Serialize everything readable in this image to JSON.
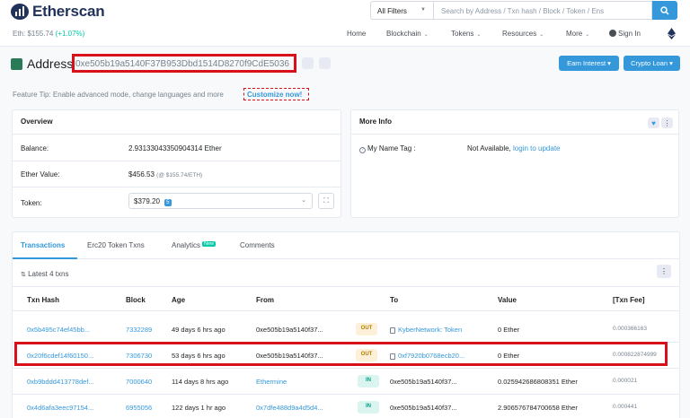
{
  "header": {
    "logo_text": "Etherscan",
    "filter_label": "All Filters",
    "search_placeholder": "Search by Address / Txn hash / Block / Token / Ens",
    "eth_price_label": "Eth: $155.74",
    "eth_price_change": "(+1.07%)",
    "nav": [
      {
        "label": "Home",
        "dropdown": false
      },
      {
        "label": "Blockchain",
        "dropdown": true
      },
      {
        "label": "Tokens",
        "dropdown": true
      },
      {
        "label": "Resources",
        "dropdown": true
      },
      {
        "label": "More",
        "dropdown": true
      },
      {
        "label": "Sign In",
        "dropdown": false
      }
    ]
  },
  "address": {
    "title": "Address",
    "hash": "0xe505b19a5140F37B953Dbd1514D8270f9CdE5036",
    "buttons": {
      "earn_interest": "Earn Interest",
      "crypto_loan": "Crypto Loan"
    }
  },
  "feature_tip": {
    "text": "Feature Tip: Enable advanced mode, change languages and more",
    "link": "Customize now!"
  },
  "overview": {
    "title": "Overview",
    "balance_label": "Balance:",
    "balance_value": "2.93133043350904314 Ether",
    "ether_value_label": "Ether Value:",
    "ether_value": "$456.53",
    "ether_value_rate": "(@ $155.74/ETH)",
    "token_label": "Token:",
    "token_value": "$379.20",
    "token_count": "5"
  },
  "more_info": {
    "title": "More Info",
    "name_tag_label": "My Name Tag :",
    "name_tag_value": "Not Available,",
    "name_tag_link": "login to update"
  },
  "tabs": [
    {
      "label": "Transactions",
      "active": true
    },
    {
      "label": "Erc20 Token Txns",
      "active": false
    },
    {
      "label": "Analytics",
      "active": false,
      "badge": "New"
    },
    {
      "label": "Comments",
      "active": false
    }
  ],
  "latest_txns": "Latest 4 txns",
  "table": {
    "columns": [
      "Txn Hash",
      "Block",
      "Age",
      "From",
      "To",
      "Value",
      "[Txn Fee]"
    ],
    "rows": [
      {
        "hash": "0x5b495c74ef45bb...",
        "block": "7332289",
        "age": "49 days 6 hrs ago",
        "from": "0xe505b19a5140f37...",
        "from_link": false,
        "dir": "OUT",
        "to": "KyberNetwork: Token",
        "to_contract": true,
        "value": "0 Ether",
        "fee": "0.000366163"
      },
      {
        "hash": "0x20f6cdef14f60150...",
        "block": "7306730",
        "age": "53 days 6 hrs ago",
        "from": "0xe505b19a5140f37...",
        "from_link": false,
        "dir": "OUT",
        "to": "0xf7920b0768ecb20...",
        "to_contract": true,
        "value": "0 Ether",
        "fee": "0.000822874999"
      },
      {
        "hash": "0xb9bddd413778def...",
        "block": "7000640",
        "age": "114 days 8 hrs ago",
        "from": "Ethermine",
        "from_link": true,
        "dir": "IN",
        "to": "0xe505b19a5140f37...",
        "to_contract": false,
        "value": "0.025942686808351 Ether",
        "fee": "0.000021"
      },
      {
        "hash": "0x4d6afa3eec97154...",
        "block": "6955056",
        "age": "122 days 1 hr ago",
        "from": "0x7dfe488d9a4d5d4...",
        "from_link": true,
        "dir": "IN",
        "to": "0xe505b19a5140f37...",
        "to_contract": false,
        "value": "2.906576784700658 Ether",
        "fee": "0.000441"
      }
    ]
  },
  "colors": {
    "accent": "#3498db",
    "brand": "#21325b",
    "highlight": "#d8101a",
    "positive": "#00c9a7"
  }
}
